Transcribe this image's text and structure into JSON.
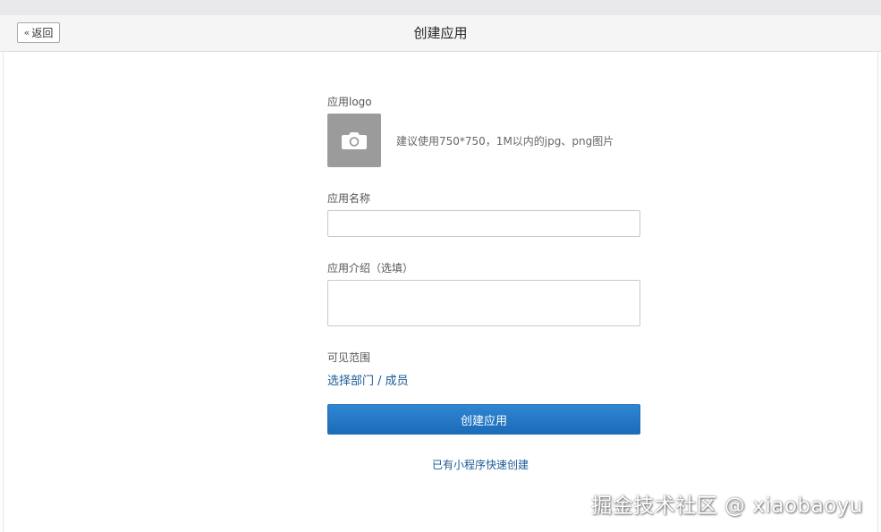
{
  "header": {
    "back_label": "返回",
    "title": "创建应用"
  },
  "form": {
    "logo_label": "应用logo",
    "logo_icon": "camera-icon",
    "logo_hint": "建议使用750*750，1M以内的jpg、png图片",
    "name_label": "应用名称",
    "name_value": "",
    "intro_label": "应用介绍（选填）",
    "intro_value": "",
    "visibility_label": "可见范围",
    "visibility_link": "选择部门 / 成员",
    "submit_label": "创建应用",
    "mini_program_link": "已有小程序快速创建"
  },
  "watermark": "掘金技术社区 @ xiaobaoyu",
  "colors": {
    "primary": "#1c6cb8",
    "link": "#1a5a96",
    "logo_box": "#9b9b9b"
  }
}
